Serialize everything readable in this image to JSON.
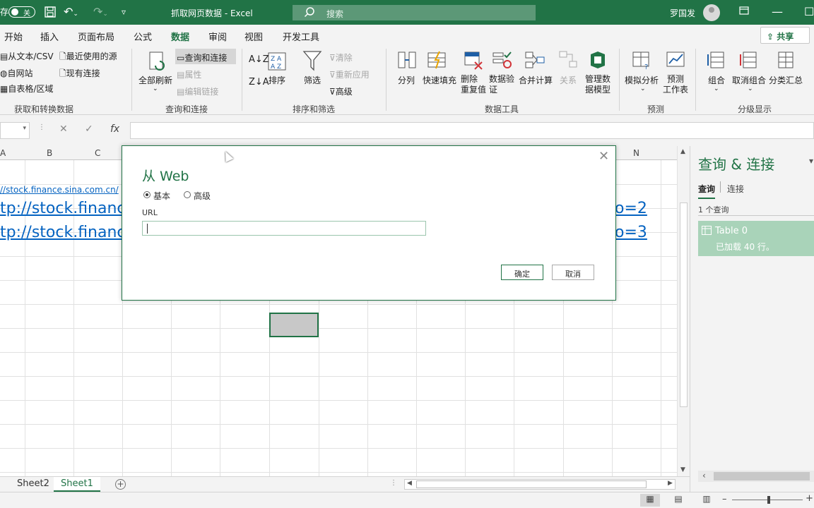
{
  "titlebar": {
    "autosave_label": "存",
    "autosave_state": "关",
    "doc_title": "抓取网页数据 - Excel",
    "search_placeholder": "搜索",
    "user_name": "罗国发"
  },
  "ribbon_tabs": [
    "开始",
    "插入",
    "页面布局",
    "公式",
    "数据",
    "审阅",
    "视图",
    "开发工具"
  ],
  "active_tab": "数据",
  "share_label": "共享",
  "ribbon": {
    "get_data": {
      "items": [
        "从文本/CSV",
        "自网站",
        "自表格/区域",
        "最近使用的源",
        "现有连接"
      ],
      "group_label": "获取和转换数据"
    },
    "queries": {
      "refresh_label": "全部刷新",
      "items": [
        "查询和连接",
        "属性",
        "编辑链接"
      ],
      "group_label": "查询和连接"
    },
    "sort": {
      "sort_label": "排序",
      "filter_label": "筛选",
      "items": [
        "清除",
        "重新应用",
        "高级"
      ],
      "group_label": "排序和筛选"
    },
    "tools": {
      "items": [
        "分列",
        "快速填充",
        "删除\n重复值",
        "数据验\n证",
        "合并计算",
        "关系",
        "管理数\n据模型"
      ],
      "group_label": "数据工具"
    },
    "forecast": {
      "items": [
        "模拟分析",
        "预测\n工作表"
      ],
      "group_label": "预测"
    },
    "outline": {
      "items": [
        "组合",
        "取消组合",
        "分类汇总"
      ],
      "group_label": "分级显示"
    }
  },
  "formula_bar": {
    "fx_label": "fx",
    "value": ""
  },
  "grid": {
    "columns": [
      "A",
      "B",
      "C",
      "N"
    ],
    "cells": [
      "//stock.finance.sina.com.cn/",
      "tp://stock.financ",
      "tp://stock.financ",
      "o=2",
      "o=3"
    ]
  },
  "sheets": [
    "Sheet2",
    "Sheet1"
  ],
  "active_sheet": "Sheet1",
  "pane": {
    "title": "查询 & 连接",
    "tabs": [
      "查询",
      "连接"
    ],
    "count_label": "1 个查询",
    "query_name": "Table 0",
    "query_status": "已加载 40 行。"
  },
  "dialog": {
    "title": "从 Web",
    "radio_basic": "基本",
    "radio_advanced": "高级",
    "url_label": "URL",
    "url_value": "",
    "ok_label": "确定",
    "cancel_label": "取消"
  },
  "colors": {
    "accent": "#217346",
    "link": "#0563c1",
    "query_bg": "#a9d3b9"
  }
}
